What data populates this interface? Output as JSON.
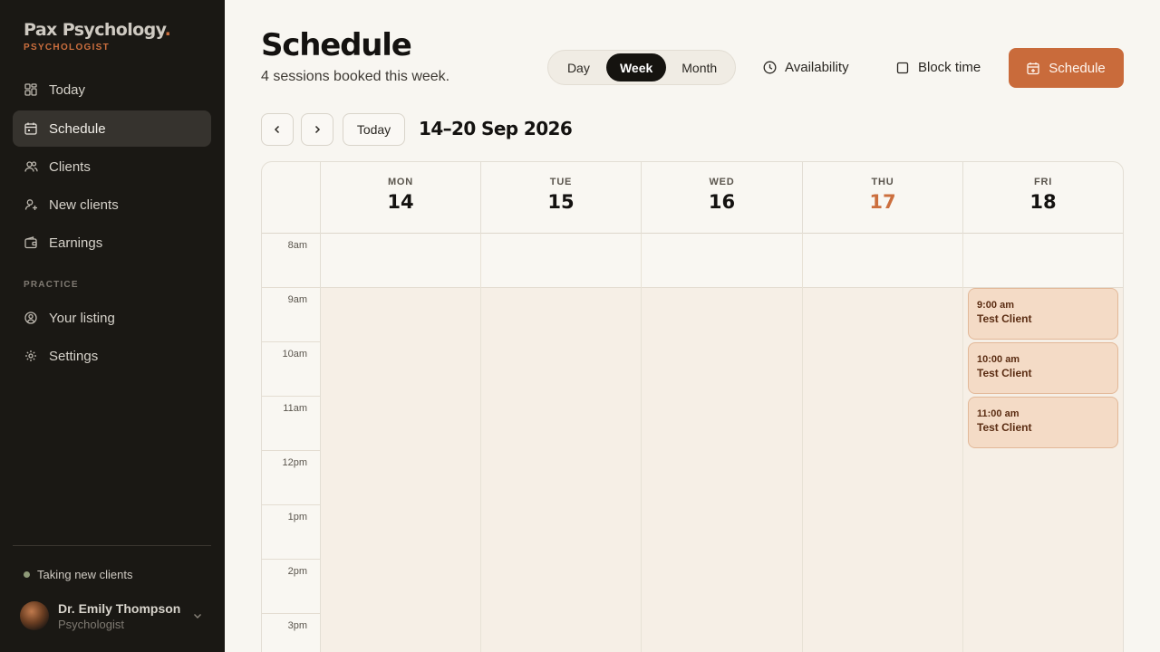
{
  "brand": {
    "name": "Pax Psychology",
    "dot": ".",
    "role": "PSYCHOLOGIST",
    "accent": "#cc6f3e"
  },
  "nav": {
    "items": [
      {
        "label": "Today",
        "icon": "grid-icon"
      },
      {
        "label": "Schedule",
        "icon": "calendar-icon",
        "active": true
      },
      {
        "label": "Clients",
        "icon": "users-icon"
      },
      {
        "label": "New clients",
        "icon": "user-plus-icon"
      },
      {
        "label": "Earnings",
        "icon": "wallet-icon"
      }
    ],
    "section": "PRACTICE",
    "practice_items": [
      {
        "label": "Your listing",
        "icon": "user-circle-icon"
      },
      {
        "label": "Settings",
        "icon": "gear-icon"
      }
    ]
  },
  "status": {
    "text": "Taking new clients",
    "color": "#8e9a78"
  },
  "user": {
    "name": "Dr. Emily Thompson",
    "role": "Psychologist"
  },
  "header": {
    "title": "Schedule",
    "subtitle": "4 sessions booked this week.",
    "view_tabs": [
      "Day",
      "Week",
      "Month"
    ],
    "active_view": "Week",
    "availability_label": "Availability",
    "block_time_label": "Block time",
    "schedule_label": "Schedule",
    "primary_color": "#c96b3b"
  },
  "toolbar": {
    "today_label": "Today",
    "range": "14–20 Sep 2026"
  },
  "calendar": {
    "days": [
      {
        "name": "MON",
        "num": "14"
      },
      {
        "name": "TUE",
        "num": "15"
      },
      {
        "name": "WED",
        "num": "16"
      },
      {
        "name": "THU",
        "num": "17",
        "today": true
      },
      {
        "name": "FRI",
        "num": "18"
      }
    ],
    "hours": [
      "8am",
      "9am",
      "10am",
      "11am",
      "12pm",
      "1pm",
      "2pm",
      "3pm"
    ],
    "events": [
      {
        "day": "FRI",
        "hour": "9am",
        "time": "9:00 am",
        "client": "Test Client"
      },
      {
        "day": "FRI",
        "hour": "10am",
        "time": "10:00 am",
        "client": "Test Client"
      },
      {
        "day": "FRI",
        "hour": "11am",
        "time": "11:00 am",
        "client": "Test Client"
      }
    ]
  }
}
